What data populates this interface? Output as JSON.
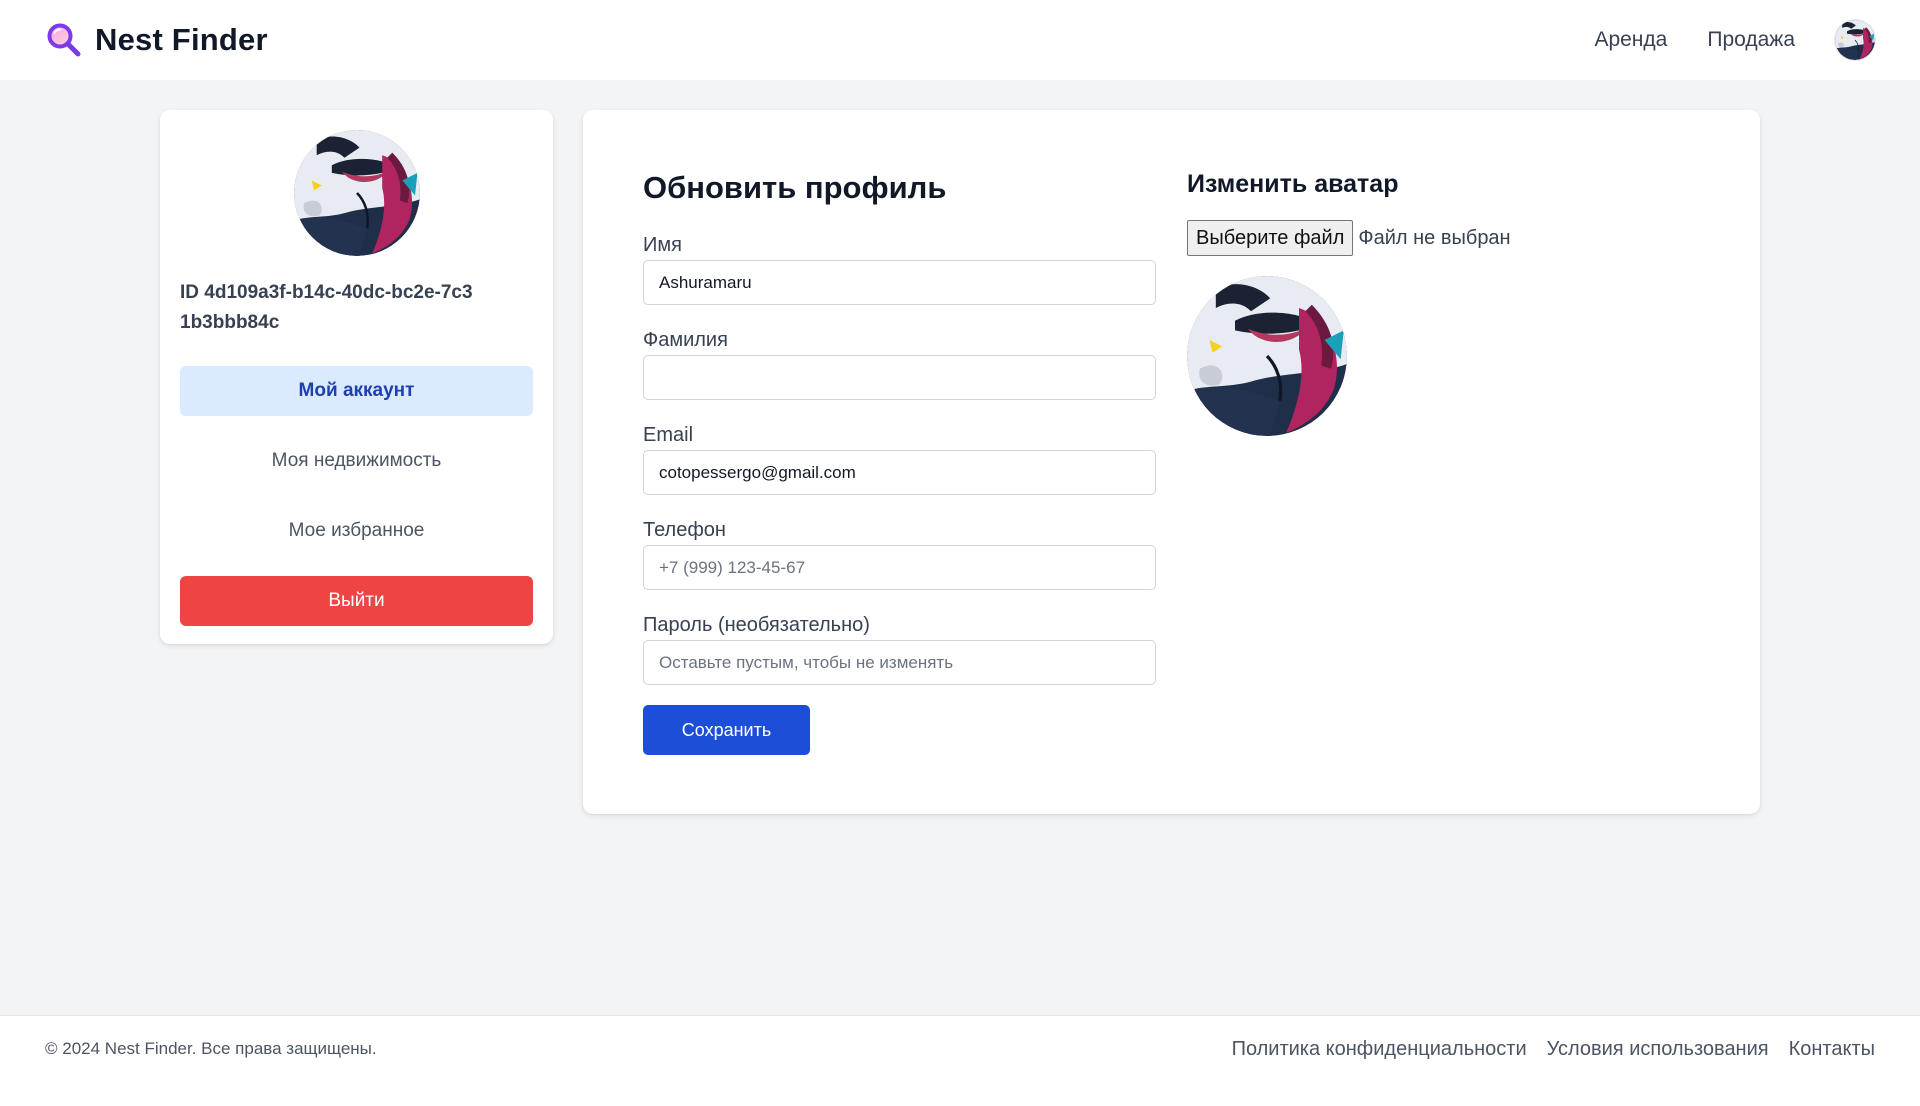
{
  "header": {
    "brand": "Nest Finder",
    "brand_icon": "search-icon",
    "nav": [
      {
        "label": "Аренда"
      },
      {
        "label": "Продажа"
      }
    ]
  },
  "sidebar": {
    "user_id": "ID 4d109a3f-b14c-40dc-bc2e-7c31b3bbb84c",
    "menu": [
      {
        "label": "Мой аккаунт",
        "active": true
      },
      {
        "label": "Моя недвижимость"
      },
      {
        "label": "Мое избранное"
      }
    ],
    "logout_label": "Выйти"
  },
  "profile_form": {
    "title": "Обновить профиль",
    "first_name": {
      "label": "Имя",
      "value": "Ashuramaru",
      "placeholder": ""
    },
    "last_name": {
      "label": "Фамилия",
      "value": "",
      "placeholder": ""
    },
    "email": {
      "label": "Email",
      "value": "cotopessergo@gmail.com",
      "placeholder": ""
    },
    "phone": {
      "label": "Телефон",
      "value": "",
      "placeholder": "+7 (999) 123-45-67"
    },
    "password": {
      "label": "Пароль (необязательно)",
      "value": "",
      "placeholder": "Оставьте пустым, чтобы не изменять"
    },
    "save_label": "Сохранить"
  },
  "avatar_section": {
    "title": "Изменить аватар",
    "file_button_label": "Выберите файл",
    "file_status": "Файл не выбран"
  },
  "footer": {
    "copyright": "© 2024 Nest Finder. Все права защищены.",
    "links": [
      {
        "label": "Политика конфиденциальности"
      },
      {
        "label": "Условия использования"
      },
      {
        "label": "Контакты"
      }
    ]
  },
  "colors": {
    "primary": "#1d4ed8",
    "active_bg": "#dbeafe",
    "danger": "#ef4444",
    "brand_icon": "#7c3aed",
    "page_bg": "#f3f4f6"
  }
}
